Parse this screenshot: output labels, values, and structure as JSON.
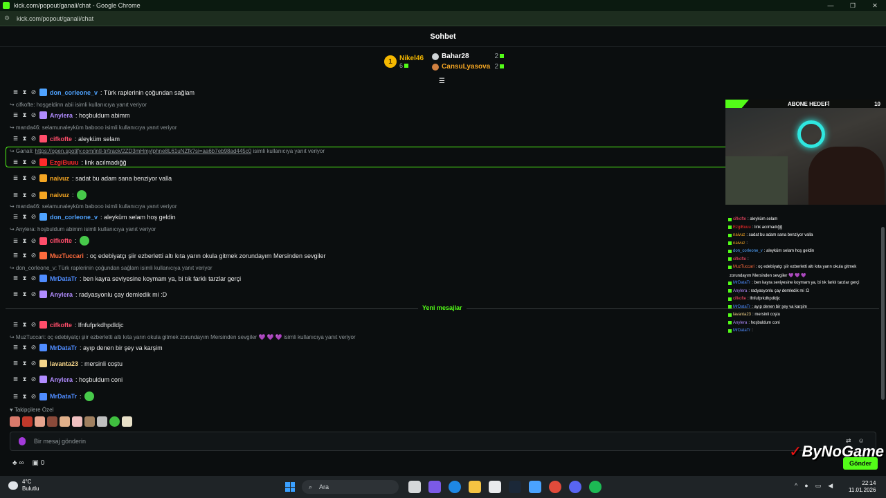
{
  "window": {
    "title": "kick.com/popout/ganali/chat - Google Chrome",
    "url": "kick.com/popout/ganali/chat",
    "brand_color": "#53fc18"
  },
  "chat_header": {
    "title": "Sohbet"
  },
  "leaderboard": {
    "first": {
      "rank": "1",
      "name": "Nikel46",
      "count": "6"
    },
    "others": [
      {
        "name": "Bahar28",
        "count": "2",
        "color": "#ffffff"
      },
      {
        "name": "CansuLyasova",
        "count": "2",
        "color": "#f5a623"
      }
    ]
  },
  "messages": [
    {
      "type": "msg",
      "user": "don_corleone_v",
      "color": "#4fa3ff",
      "text": ": Türk raplerinin çoğundan sağlam"
    },
    {
      "type": "reply",
      "text": "cifkofte: hoşgeldinn abii isimli kullanıcıya yanıt veriyor"
    },
    {
      "type": "msg",
      "user": "Anylera",
      "color": "#b18cff",
      "text": ": hoşbuldum abimm"
    },
    {
      "type": "reply",
      "text": "manda46: selamunaleyküm babooo isimli kullanıcıya yanıt veriyor"
    },
    {
      "type": "msg",
      "user": "cifkofte",
      "color": "#ff4d6a",
      "text": ": aleyküm selam"
    },
    {
      "type": "reply_link",
      "prefix": "Ganali: ",
      "link": "https://open.spotify.com/intl-tr/track/2ZD3mHmylphne8L61uNZfk?si=aa6b7eb98ad445c0",
      "suffix": " isimli kullanıcıya yanıt veriyor"
    },
    {
      "type": "msg",
      "user": "EzgiBuuu",
      "color": "#ff2b2b",
      "text": ": link acılmadığğ"
    },
    {
      "type": "msg",
      "user": "naivuz",
      "color": "#f5a623",
      "text": ": sadat bu adam sana benziyor valla"
    },
    {
      "type": "msg",
      "user": "naivuz",
      "color": "#f5a623",
      "text": ":"
    },
    {
      "type": "reply",
      "text": "manda46: selamunaleyküm babooo isimli kullanıcıya yanıt veriyor"
    },
    {
      "type": "msg",
      "user": "don_corleone_v",
      "color": "#4fa3ff",
      "text": ": aleyküm selam hoş geldin"
    },
    {
      "type": "reply",
      "text": "Anylera: hoşbuldum abimm isimli kullanıcıya yanıt veriyor"
    },
    {
      "type": "msg",
      "user": "cifkofte",
      "color": "#ff4d6a",
      "text": ":"
    },
    {
      "type": "msg",
      "user": "MuzTuccari",
      "color": "#ff6b3d",
      "text": ": oç edebiyatçı şiir ezberletti altı kıta yarın okula gitmek zorundayım Mersinden sevgiler"
    },
    {
      "type": "reply",
      "text": "don_corleone_v: Türk raplerinin çoğundan sağlam isimli kullanıcıya yanıt veriyor"
    },
    {
      "type": "msg",
      "user": "MrDataTr",
      "color": "#4f8cff",
      "text": ": ben kayra seviyesine koymam ya, bi tık farklı tarzlar gerçi"
    },
    {
      "type": "msg",
      "user": "Anylera",
      "color": "#b18cff",
      "text": ": radyasyonlu çay demledik mi :D"
    },
    {
      "type": "msg",
      "user": "cifkofte",
      "color": "#ff4d6a",
      "text": ": lfnfufprkdhpdldjc"
    },
    {
      "type": "reply",
      "text": "MuzTuccari: oç edebiyatçı şiir ezberletti altı kıta yarın okula gitmek zorundayım Mersinden sevgiler 💜 💜 💜 isimli kullanıcıya yanıt veriyor"
    },
    {
      "type": "msg",
      "user": "MrDataTr",
      "color": "#4f8cff",
      "text": ": ayıp denen bir şey va karşim"
    },
    {
      "type": "msg",
      "user": "lavanta23",
      "color": "#f5d58a",
      "text": ": mersinli coştu"
    },
    {
      "type": "msg",
      "user": "Anylera",
      "color": "#b18cff",
      "text": ": hoşbuldum coni"
    },
    {
      "type": "msg",
      "user": "MrDataTr",
      "color": "#4f8cff",
      "text": ":"
    }
  ],
  "new_messages_label": "Yeni mesajlar",
  "followers_only": "Takipçilere Özel",
  "input": {
    "placeholder": "Bir mesaj gönderin",
    "send_label": "Gönder"
  },
  "bottom": {
    "infinity": "∞",
    "count": "0"
  },
  "overlay": {
    "goal_label": "ABONE HEDEFİ",
    "goal_value": "10",
    "lines": [
      {
        "user": "cifkofte",
        "text": ": aleyküm selam",
        "color": "#ff4d6a"
      },
      {
        "user": "EzgiBuuu",
        "text": ": link acılmadığğ",
        "color": "#ff2b2b"
      },
      {
        "user": "naivuz",
        "text": ": sadat bu adam sana benziyor valla",
        "color": "#f5a623"
      },
      {
        "user": "naivuz",
        "text": ":",
        "color": "#f5a623"
      },
      {
        "user": "don_corleone_v",
        "text": ": aleyküm selam hoş geldin",
        "color": "#4fa3ff"
      },
      {
        "user": "cifkofte",
        "text": ":",
        "color": "#ff4d6a"
      },
      {
        "user": "MuzTuccari",
        "text": ": oç edebiyatçı şiir ezberletti altı kıta yarın okula gitmek",
        "color": "#ff6b3d"
      },
      {
        "user": "",
        "text": "zorundayım Mersinden sevgiler 💜 💜 💜",
        "color": "#ffffff"
      },
      {
        "user": "MrDataTr",
        "text": ": ben kayra seviyesine koymam ya, bi tık farklı tarzlar gerçi",
        "color": "#4f8cff"
      },
      {
        "user": "Anylera",
        "text": ": radyasyonlu çay demledik mi :D",
        "color": "#b18cff"
      },
      {
        "user": "cifkofte",
        "text": ": lfnfufprkdhpdldjc",
        "color": "#ff4d6a"
      },
      {
        "user": "MrDataTr",
        "text": ": ayıp denen bir şey va karşim",
        "color": "#4f8cff"
      },
      {
        "user": "lavanta23",
        "text": ": mersinli coştu",
        "color": "#f5d58a"
      },
      {
        "user": "Anylera",
        "text": ": hoşbuldum coni",
        "color": "#b18cff"
      },
      {
        "user": "MrDataTr",
        "text": ":",
        "color": "#4f8cff"
      }
    ]
  },
  "watermark": "ByNoGame",
  "taskbar": {
    "temp": "4°C",
    "weather": "Bulutlu",
    "search": "Ara",
    "time": "22:14",
    "date": "11.01.2026"
  }
}
